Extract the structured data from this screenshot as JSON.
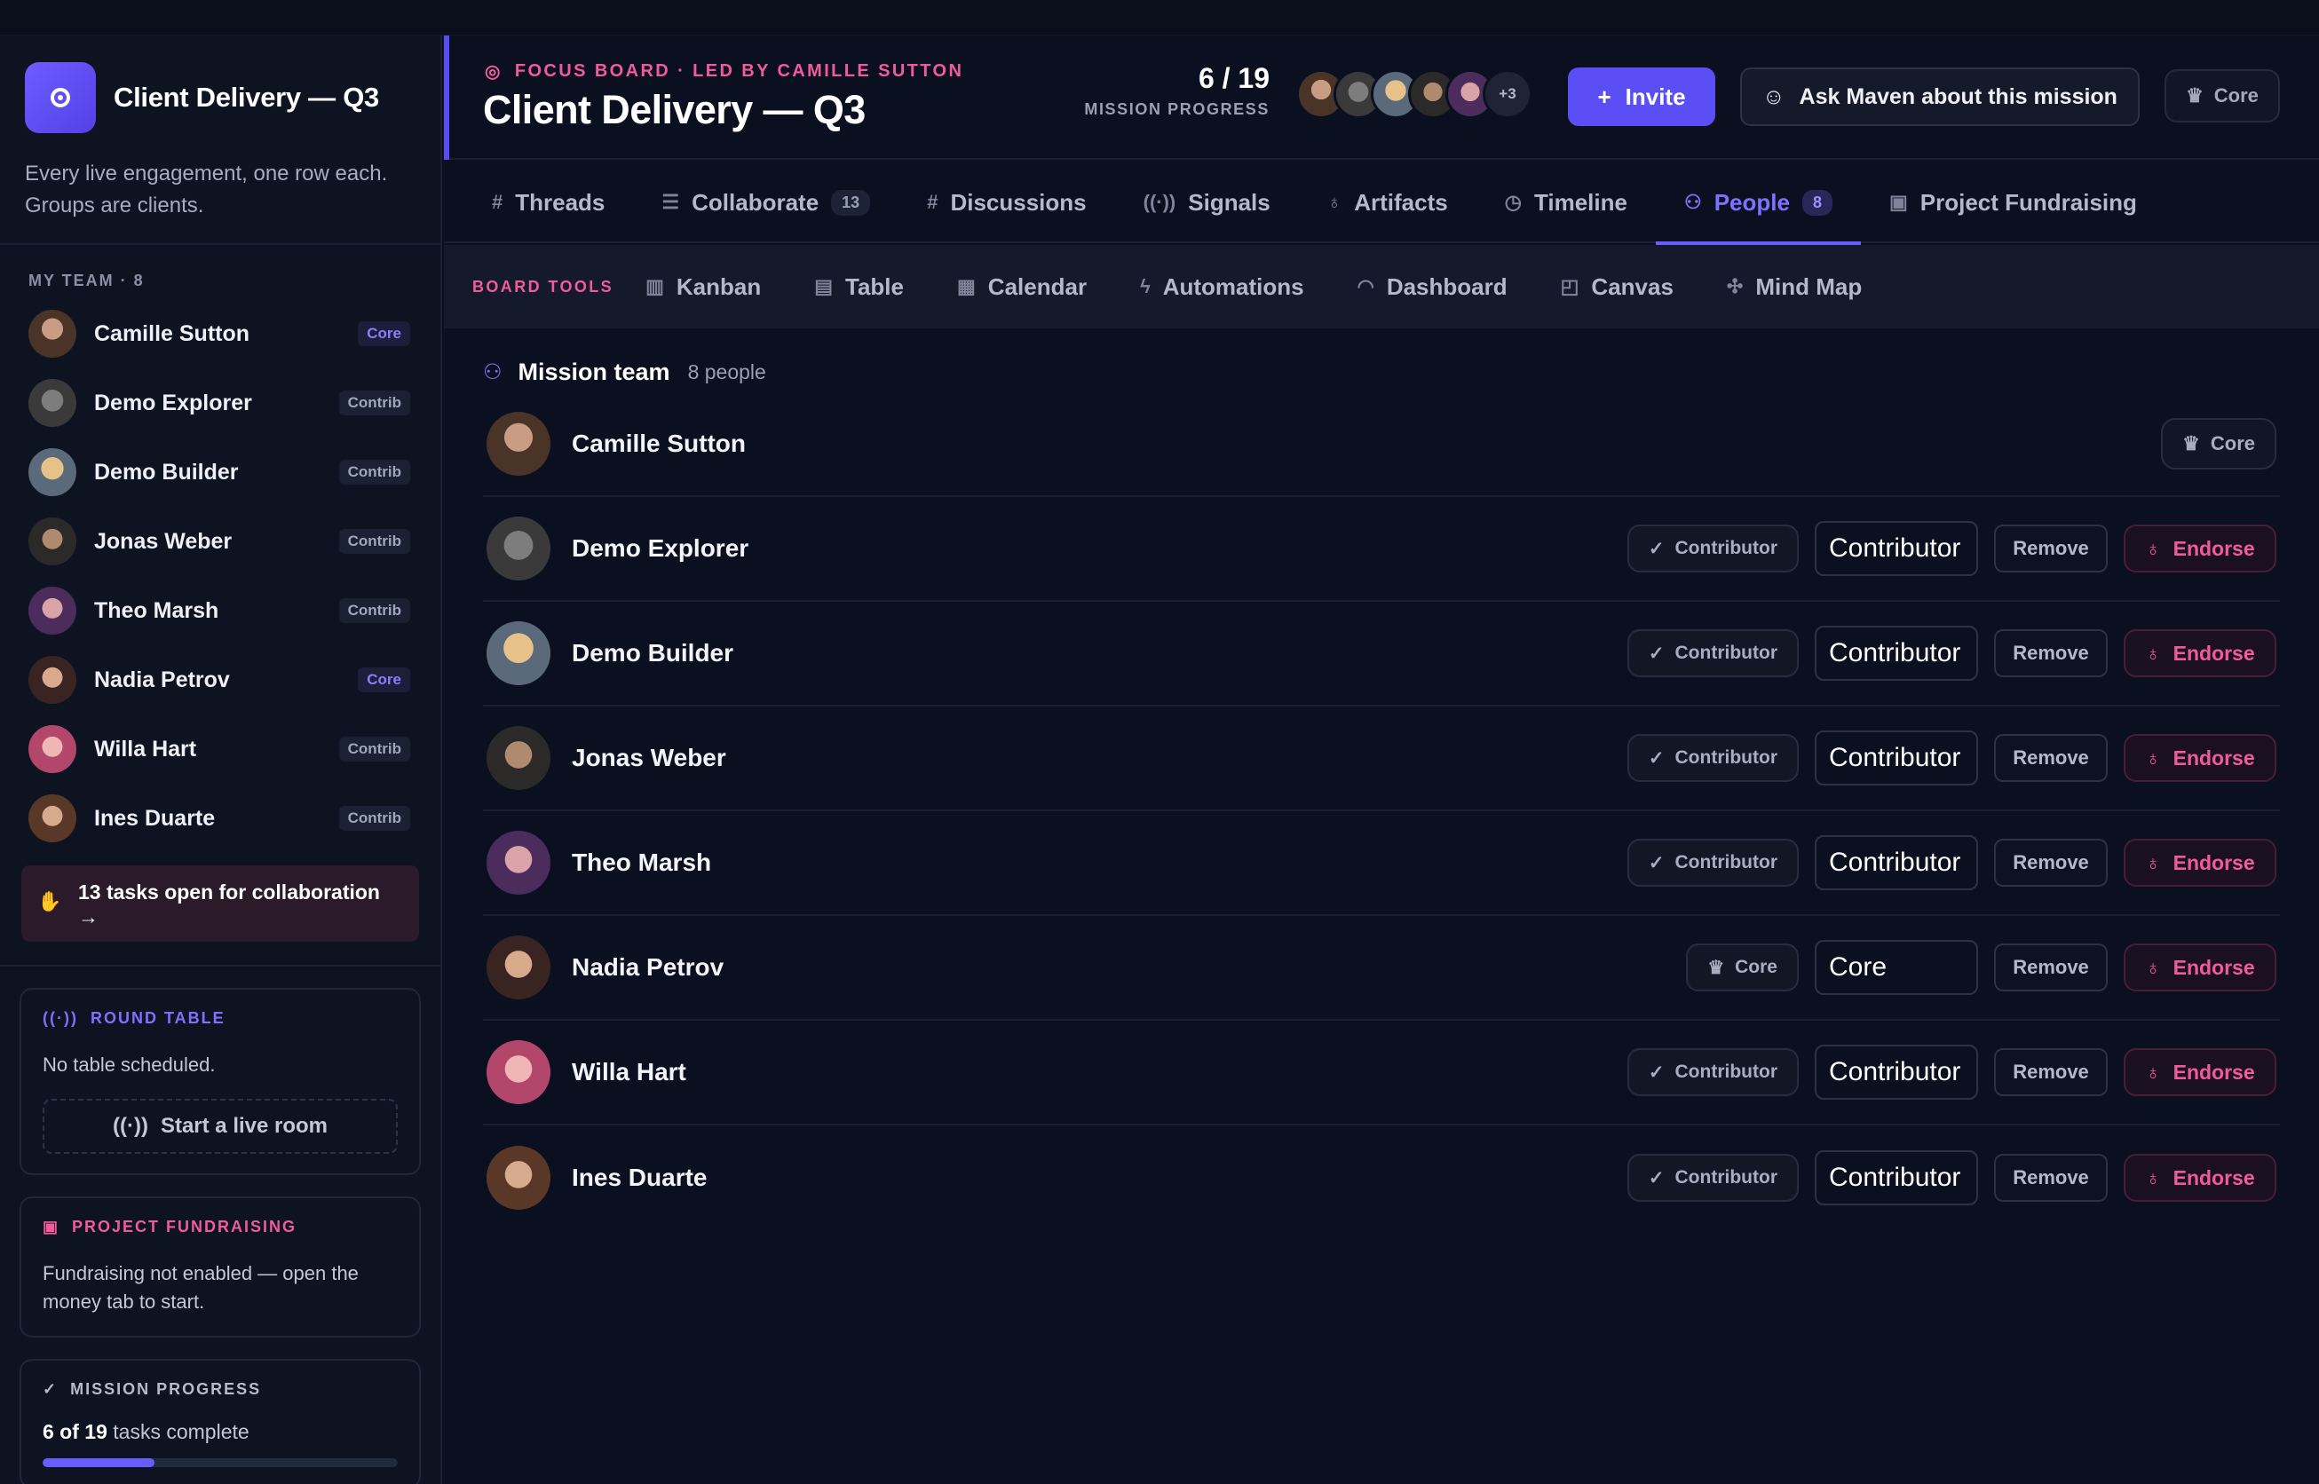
{
  "sidebar": {
    "title": "Client Delivery — Q3",
    "description": "Every live engagement, one row each. Groups are clients.",
    "team_label": "MY TEAM · 8",
    "members": [
      {
        "name": "Camille Sutton",
        "badge": "Core"
      },
      {
        "name": "Demo Explorer",
        "badge": "Contrib"
      },
      {
        "name": "Demo Builder",
        "badge": "Contrib"
      },
      {
        "name": "Jonas Weber",
        "badge": "Contrib"
      },
      {
        "name": "Theo Marsh",
        "badge": "Contrib"
      },
      {
        "name": "Nadia Petrov",
        "badge": "Core"
      },
      {
        "name": "Willa Hart",
        "badge": "Contrib"
      },
      {
        "name": "Ines Duarte",
        "badge": "Contrib"
      }
    ],
    "collab_text": "13 tasks open for collaboration →",
    "round_table": {
      "label": "ROUND TABLE",
      "text": "No table scheduled.",
      "button": "Start a live room"
    },
    "fundraising": {
      "label": "PROJECT FUNDRAISING",
      "text": "Fundraising not enabled — open the money tab to start."
    },
    "progress": {
      "label": "MISSION PROGRESS",
      "count": "6 of 19",
      "suffix": "tasks complete",
      "fraction": 0.316
    }
  },
  "header": {
    "kicker": "FOCUS BOARD · LED BY CAMILLE SUTTON",
    "title": "Client Delivery — Q3",
    "progress_value": "6 / 19",
    "progress_label": "MISSION PROGRESS",
    "avatars_more": "+3",
    "invite_label": "Invite",
    "ask_label": "Ask Maven about this mission",
    "role_label": "Core"
  },
  "tabs": [
    {
      "label": "Threads",
      "icon": "#"
    },
    {
      "label": "Collaborate",
      "icon": "☰",
      "count": "13"
    },
    {
      "label": "Discussions",
      "icon": "#"
    },
    {
      "label": "Signals",
      "icon": "((·))"
    },
    {
      "label": "Artifacts",
      "icon": "award"
    },
    {
      "label": "Timeline",
      "icon": "clock"
    },
    {
      "label": "People",
      "icon": "users",
      "count": "8",
      "active": true
    },
    {
      "label": "Project Fundraising",
      "icon": "money"
    }
  ],
  "board_tools": {
    "label": "BOARD TOOLS",
    "items": [
      "Kanban",
      "Table",
      "Calendar",
      "Automations",
      "Dashboard",
      "Canvas",
      "Mind Map"
    ]
  },
  "team": {
    "title": "Mission team",
    "count": "8 people",
    "rows": [
      {
        "name": "Camille Sutton",
        "role_pill": "Core",
        "owner": true
      },
      {
        "name": "Demo Explorer",
        "role_pill": "Contributor",
        "select": "Contributor",
        "remove": "Remove",
        "endorse": "Endorse"
      },
      {
        "name": "Demo Builder",
        "role_pill": "Contributor",
        "select": "Contributor",
        "remove": "Remove",
        "endorse": "Endorse"
      },
      {
        "name": "Jonas Weber",
        "role_pill": "Contributor",
        "select": "Contributor",
        "remove": "Remove",
        "endorse": "Endorse"
      },
      {
        "name": "Theo Marsh",
        "role_pill": "Contributor",
        "select": "Contributor",
        "remove": "Remove",
        "endorse": "Endorse"
      },
      {
        "name": "Nadia Petrov",
        "role_pill": "Core",
        "select": "Core",
        "remove": "Remove",
        "endorse": "Endorse"
      },
      {
        "name": "Willa Hart",
        "role_pill": "Contributor",
        "select": "Contributor",
        "remove": "Remove",
        "endorse": "Endorse"
      },
      {
        "name": "Ines Duarte",
        "role_pill": "Contributor",
        "select": "Contributor",
        "remove": "Remove",
        "endorse": "Endorse"
      }
    ]
  },
  "colors": {
    "accent": "#5b4ef5",
    "pink": "#f05b9b",
    "bg": "#0b1020"
  }
}
